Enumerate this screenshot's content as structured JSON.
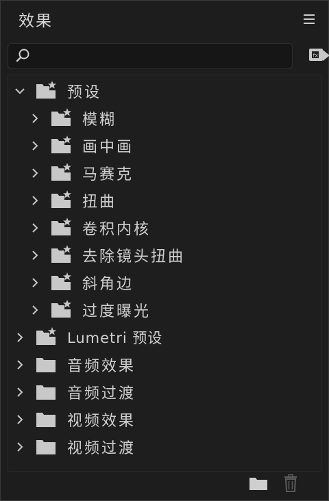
{
  "panel": {
    "title": "效果"
  },
  "search": {
    "value": "",
    "placeholder": ""
  },
  "tree": [
    {
      "label": "预设",
      "icon": "preset-folder-icon",
      "expanded": true,
      "depth": 0
    },
    {
      "label": "模糊",
      "icon": "preset-folder-icon",
      "expanded": false,
      "depth": 1
    },
    {
      "label": "画中画",
      "icon": "preset-folder-icon",
      "expanded": false,
      "depth": 1
    },
    {
      "label": "马赛克",
      "icon": "preset-folder-icon",
      "expanded": false,
      "depth": 1
    },
    {
      "label": "扭曲",
      "icon": "preset-folder-icon",
      "expanded": false,
      "depth": 1
    },
    {
      "label": "卷积内核",
      "icon": "preset-folder-icon",
      "expanded": false,
      "depth": 1
    },
    {
      "label": "去除镜头扭曲",
      "icon": "preset-folder-icon",
      "expanded": false,
      "depth": 1
    },
    {
      "label": "斜角边",
      "icon": "preset-folder-icon",
      "expanded": false,
      "depth": 1
    },
    {
      "label": "过度曝光",
      "icon": "preset-folder-icon",
      "expanded": false,
      "depth": 1
    },
    {
      "label": "Lumetri 预设",
      "icon": "preset-folder-icon",
      "expanded": false,
      "depth": 0
    },
    {
      "label": "音频效果",
      "icon": "folder-icon",
      "expanded": false,
      "depth": 0
    },
    {
      "label": "音频过渡",
      "icon": "folder-icon",
      "expanded": false,
      "depth": 0
    },
    {
      "label": "视频效果",
      "icon": "folder-icon",
      "expanded": false,
      "depth": 0
    },
    {
      "label": "视频过渡",
      "icon": "folder-icon",
      "expanded": false,
      "depth": 0
    }
  ],
  "colors": {
    "background": "#1d1d1d",
    "tree_background": "#1e1e1e",
    "text": "#d0d0d0",
    "icon": "#c8c8c8"
  }
}
